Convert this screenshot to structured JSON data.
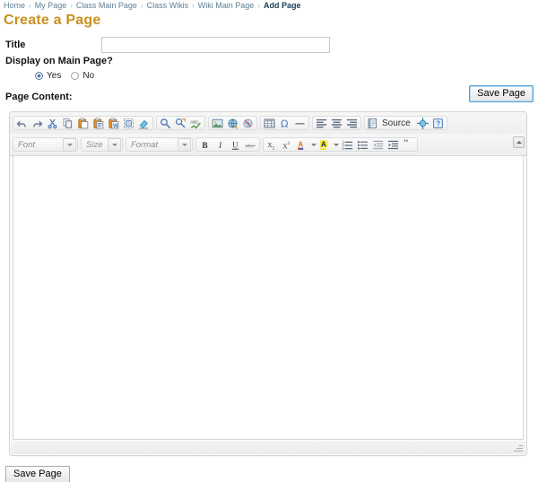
{
  "breadcrumb": {
    "separator": "›",
    "items": [
      {
        "label": "Home",
        "current": false
      },
      {
        "label": "My Page",
        "current": false
      },
      {
        "label": "Class Main Page",
        "current": false
      },
      {
        "label": "Class Wikis",
        "current": false
      },
      {
        "label": "Wiki Main Page",
        "current": false
      },
      {
        "label": "Add Page",
        "current": true
      }
    ]
  },
  "page": {
    "title": "Create a Page",
    "title_color": "#c8901e"
  },
  "form": {
    "title_label": "Title",
    "title_value": "",
    "title_placeholder": "",
    "display_label": "Display on Main Page?",
    "radio_yes": "Yes",
    "radio_no": "No",
    "radio_selected": "Yes",
    "content_label": "Page Content:"
  },
  "actions": {
    "save_top_label": "Save Page",
    "save_bottom_label": "Save Page"
  },
  "editor": {
    "content": "",
    "source_label": "Source",
    "toolbar_row1": [
      {
        "group": 1,
        "name": "undo-icon",
        "title": "Undo"
      },
      {
        "group": 1,
        "name": "redo-icon",
        "title": "Redo"
      },
      {
        "group": 1,
        "name": "cut-icon",
        "title": "Cut"
      },
      {
        "group": 1,
        "name": "copy-icon",
        "title": "Copy"
      },
      {
        "group": 1,
        "name": "paste-icon",
        "title": "Paste"
      },
      {
        "group": 1,
        "name": "paste-text-icon",
        "title": "Paste as plain text"
      },
      {
        "group": 1,
        "name": "paste-word-icon",
        "title": "Paste from Word"
      },
      {
        "group": 1,
        "name": "select-all-icon",
        "title": "Select All"
      },
      {
        "group": 1,
        "name": "remove-format-icon",
        "title": "Remove Format"
      },
      {
        "group": 2,
        "name": "find-icon",
        "title": "Find"
      },
      {
        "group": 2,
        "name": "replace-icon",
        "title": "Replace"
      },
      {
        "group": 2,
        "name": "spellcheck-icon",
        "title": "Spell Check As You Type"
      },
      {
        "group": 3,
        "name": "image-icon",
        "title": "Image"
      },
      {
        "group": 3,
        "name": "link-icon",
        "title": "Link"
      },
      {
        "group": 3,
        "name": "unlink-icon",
        "title": "Unlink"
      },
      {
        "group": 4,
        "name": "table-icon",
        "title": "Table"
      },
      {
        "group": 4,
        "name": "special-char-icon",
        "title": "Insert Special Character"
      },
      {
        "group": 4,
        "name": "horizontal-rule-icon",
        "title": "Insert Horizontal Line"
      },
      {
        "group": 5,
        "name": "align-left-icon",
        "title": "Align Left"
      },
      {
        "group": 5,
        "name": "align-center-icon",
        "title": "Center"
      },
      {
        "group": 5,
        "name": "align-right-icon",
        "title": "Align Right"
      },
      {
        "group": 6,
        "name": "source-icon",
        "title": "Source"
      },
      {
        "group": 6,
        "name": "maximize-icon",
        "title": "Maximize"
      },
      {
        "group": 6,
        "name": "about-icon",
        "title": "About"
      }
    ],
    "combos": [
      {
        "name": "font-select",
        "value": "Font"
      },
      {
        "name": "size-select",
        "value": "Size"
      },
      {
        "name": "format-select",
        "value": "Format"
      }
    ],
    "toolbar_row2": [
      {
        "group": 1,
        "name": "bold-icon",
        "title": "Bold"
      },
      {
        "group": 1,
        "name": "italic-icon",
        "title": "Italic"
      },
      {
        "group": 1,
        "name": "underline-icon",
        "title": "Underline"
      },
      {
        "group": 1,
        "name": "strikethrough-icon",
        "title": "Strike Through"
      },
      {
        "group": 2,
        "name": "subscript-icon",
        "title": "Subscript"
      },
      {
        "group": 2,
        "name": "superscript-icon",
        "title": "Superscript"
      },
      {
        "group": 2,
        "name": "text-color-icon",
        "title": "Text Color"
      },
      {
        "group": 2,
        "name": "background-color-icon",
        "title": "Background Color"
      },
      {
        "group": 2,
        "name": "numbered-list-icon",
        "title": "Insert/Remove Numbered List"
      },
      {
        "group": 2,
        "name": "bulleted-list-icon",
        "title": "Insert/Remove Bulleted List"
      },
      {
        "group": 2,
        "name": "outdent-icon",
        "title": "Decrease Indent"
      },
      {
        "group": 2,
        "name": "indent-icon",
        "title": "Increase Indent"
      },
      {
        "group": 2,
        "name": "blockquote-icon",
        "title": "Block Quote"
      }
    ]
  }
}
